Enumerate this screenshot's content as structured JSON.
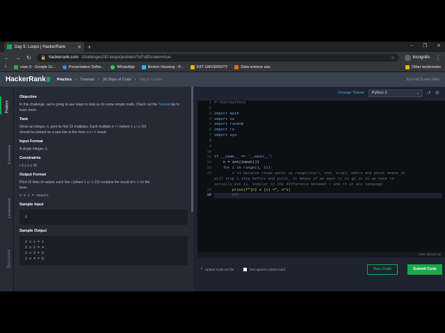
{
  "browser": {
    "tab_title": "Day 5: Loops | HackerRank",
    "url_host": "hackerrank.com",
    "url_path": "/challenges/30-loops/problem?isFullScreen=true",
    "profile": "Incognito",
    "bookmarks": [
      "csse-3 - Google Gr...",
      "Presentation Softw...",
      "WhatsApp",
      "Boston Housing - P...",
      "KIIT UNIVERSITY",
      "Data science ass."
    ],
    "other_bookmarks": "Other bookmarks"
  },
  "header": {
    "logo": "HackerRank",
    "crumbs": [
      "Practice",
      "Tutorials",
      "30 Days of Code",
      "Day 5: Loops"
    ],
    "exit_fullscreen": "Exit Full Screen View"
  },
  "side_tabs": [
    "Problem",
    "Submissions",
    "Leaderboard",
    "Discussions"
  ],
  "problem": {
    "objective_h": "Objective",
    "objective_1": "In this challenge, we're going to use loops to help us do some simple math. Check out the",
    "tutorial_link": "Tutorial",
    "objective_2": "tab to learn more.",
    "task_h": "Task",
    "task_1": "Given an integer, n, print its first 10 multiples. Each multiple n × i (where 1 ≤ i ≤ 10)",
    "task_2": "should be printed on a new line in the form: n x i = result.",
    "input_h": "Input Format",
    "input_1": "A single integer, n.",
    "constraints_h": "Constraints",
    "constraints_1": "• 2 ≤ n ≤ 20",
    "output_h": "Output Format",
    "output_1": "Print 10 lines of output; each line i (where 1 ≤ i ≤ 10) contains the result of n × i in the",
    "output_2": "form:",
    "output_3": "n x i = result",
    "sample_in_h": "Sample Input",
    "sample_in": "2",
    "sample_out_h": "Sample Output",
    "sample_out": [
      "2 x 1 = 2",
      "2 x 2 = 4",
      "2 x 3 = 6",
      "2 x 4 = 8"
    ]
  },
  "editor": {
    "change_theme": "Change Theme",
    "language": "Python 3",
    "line_numbers": [
      "1",
      "2",
      "3",
      "4",
      "5",
      "6",
      "7",
      "8",
      "9",
      "10",
      "11",
      "12",
      "13",
      "14",
      "",
      "",
      "15",
      "16"
    ],
    "lines": [
      "#!/bin/python3",
      "",
      "import math",
      "import os",
      "import random",
      "import re",
      "import sys",
      "",
      "",
      "",
      "if __name__ == '__main__':",
      "    n = int(input())",
      "    for i in range(1, 11):",
      "        # 11 because range works as range(start, end, stop), where end point means it",
      "will stop 1 step before end point. It means if we want it to go to 10 we have to",
      "actually put 11. Similar to the difference between < and <= in any language.",
      "        print(f\"{n} x {i} =\", n*i)",
      "        ###"
    ],
    "status": "Line: 16 Col: 12",
    "upload_label": "Upload Code as File",
    "custom_input_label": "Test against custom input",
    "run_label": "Run Code",
    "submit_label": "Submit Code"
  },
  "colors": {
    "accent": "#1ba94c",
    "link": "#39b0e8"
  }
}
